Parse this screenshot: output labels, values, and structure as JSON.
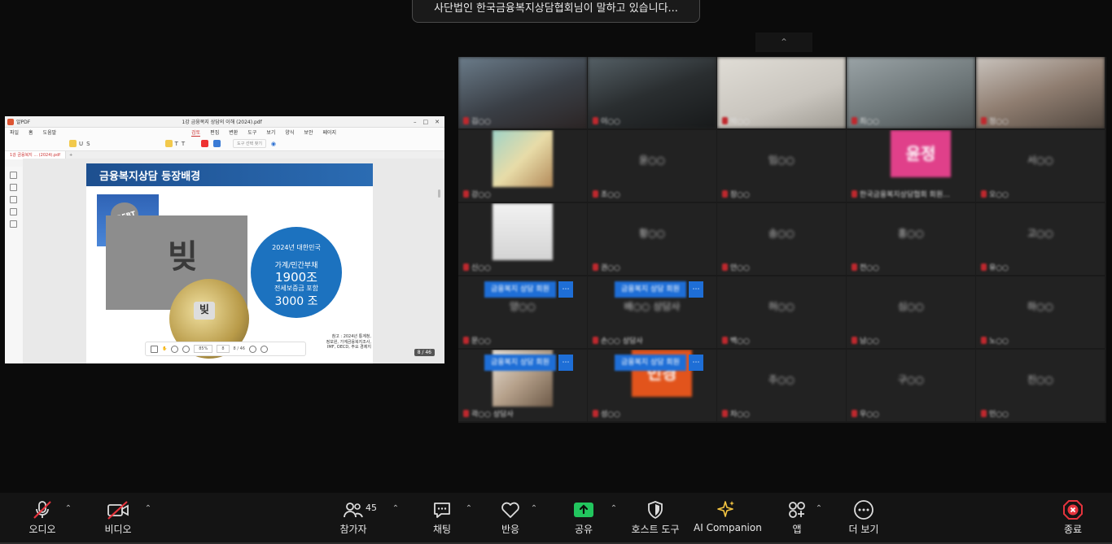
{
  "speaking_banner": "사단법인 한국금융복지상담협회님이 말하고 있습니다...",
  "pdf": {
    "app_name": "알PDF",
    "doc_title": "1강 금융복지 상담의 이해 (2024).pdf",
    "menu": [
      "파일",
      "홈",
      "도움말",
      "검토",
      "편집",
      "변환",
      "도구",
      "보기",
      "양식",
      "보안",
      "페이지"
    ],
    "active_menu": "검토",
    "search_placeholder": "도구 선택 찾기",
    "tab_label": "1강 금융복지 ... (2024).pdf",
    "zoom": "85%",
    "page_display": "8 / 46",
    "page_input": "8",
    "page_badge": "8 / 46",
    "slide": {
      "title": "금융복지상담 등장배경",
      "debt_word": "DEBT",
      "mural_char": "빚",
      "ball_char": "빚",
      "circle_line1": "2024년 대한민국",
      "circle_line2": "가계/민간부채",
      "circle_line3": "1900조",
      "circle_line4": "전세보증금 포함",
      "circle_line5": "3000 조",
      "source_line1": "참고 : 2024년 통계청,",
      "source_line2": "정보원, 가계금융복지조사,",
      "source_line3": "IMF, OECD, 주요 경제지"
    }
  },
  "gallery": {
    "tiles": [
      {
        "name": "김○○"
      },
      {
        "name": "이○○"
      },
      {
        "name": "박○○"
      },
      {
        "name": "최○○"
      },
      {
        "name": "정○○"
      },
      {
        "name": "강○○",
        "center": ""
      },
      {
        "name": "조○○",
        "center": "윤○○"
      },
      {
        "name": "장○○",
        "center": "임○○"
      },
      {
        "name": "한국금융복지상담협회 회원...",
        "center": ""
      },
      {
        "name": "오○○",
        "center": "서○○"
      },
      {
        "name": "신○○",
        "center": ""
      },
      {
        "name": "권○○",
        "center": "황○○"
      },
      {
        "name": "안○○",
        "center": "송○○"
      },
      {
        "name": "전○○",
        "center": "홍○○"
      },
      {
        "name": "유○○",
        "center": "고○○"
      },
      {
        "name": "문○○",
        "center": "양○○"
      },
      {
        "name": "손○○ 상담사",
        "center": "배○○ 상담사"
      },
      {
        "name": "백○○",
        "center": "허○○"
      },
      {
        "name": "남○○",
        "center": "심○○"
      },
      {
        "name": "노○○",
        "center": "하○○"
      },
      {
        "name": "곽○○ 상담사",
        "center": ""
      },
      {
        "name": "성○○",
        "center": ""
      },
      {
        "name": "차○○",
        "center": "주○○"
      },
      {
        "name": "우○○",
        "center": "구○○"
      },
      {
        "name": "민○○",
        "center": "진○○"
      }
    ],
    "avatar_initials": [
      "윤정",
      "민경"
    ],
    "chips": [
      "금융복지 상담 회원",
      "금융복지 상담 회원",
      "금융복지 상담 회원",
      "금융복지 상담 회원"
    ]
  },
  "toolbar": {
    "audio": "오디오",
    "video": "비디오",
    "participants": "참가자",
    "participants_count": "45",
    "chat": "채팅",
    "reactions": "반응",
    "share": "공유",
    "host_tools": "호스트 도구",
    "ai_companion": "AI Companion",
    "apps": "앱",
    "more": "더 보기",
    "end": "종료"
  },
  "colors": {
    "background": "#0b0b0b",
    "gallery_bg": "#1a1a1a",
    "mute_red": "#c0282e",
    "share_green": "#22c55e",
    "ai_gold": "#f5c542",
    "end_red": "#e5343d",
    "chip_blue": "#1e6ed6",
    "slide_circle": "#1c72bf"
  }
}
